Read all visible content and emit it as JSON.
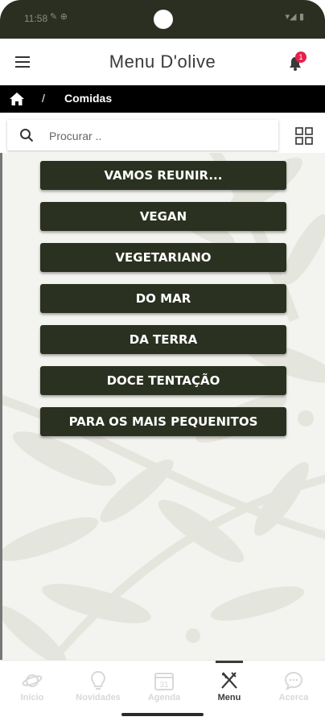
{
  "status_bar": {
    "time": "11:58",
    "icons": "✎ ⊕",
    "right_icons": "▾◢ ▮"
  },
  "header": {
    "title": "Menu D'olive",
    "notification_count": "1"
  },
  "breadcrumb": {
    "separator": "/",
    "current": "Comidas"
  },
  "search": {
    "placeholder": "Procurar ..",
    "value": ""
  },
  "categories": [
    {
      "label": "VAMOS REUNIR..."
    },
    {
      "label": "VEGAN"
    },
    {
      "label": "VEGETARIANO"
    },
    {
      "label": "DO MAR"
    },
    {
      "label": "DA TERRA"
    },
    {
      "label": "DOCE TENTAÇÃO"
    },
    {
      "label": "PARA OS MAIS PEQUENITOS"
    }
  ],
  "bottom_nav": [
    {
      "label": "Início",
      "icon": "planet-icon",
      "active": false
    },
    {
      "label": "Novidades",
      "icon": "lightbulb-icon",
      "active": false
    },
    {
      "label": "Agenda",
      "icon": "calendar-icon",
      "active": false,
      "day": "31"
    },
    {
      "label": "Menu",
      "icon": "fork-knife-icon",
      "active": true
    },
    {
      "label": "Acerca",
      "icon": "chat-icon",
      "active": false
    }
  ],
  "colors": {
    "brand_dark": "#2b3120",
    "breadcrumb_bg": "#000000",
    "badge": "#e5214a",
    "nav_inactive": "#d8d8d8"
  }
}
